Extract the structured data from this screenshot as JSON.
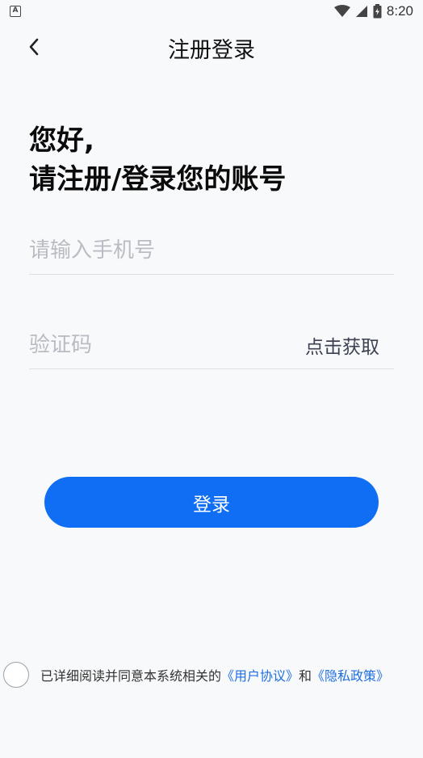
{
  "status_bar": {
    "left_icon": "A",
    "icons": [
      "wifi-icon",
      "signal-icon",
      "battery-icon"
    ],
    "time": "8:20"
  },
  "nav": {
    "back_icon": "chevron-left-icon",
    "title": "注册登录"
  },
  "greeting": {
    "line1": "您好,",
    "line2": "请注册/登录您的账号"
  },
  "phone_field": {
    "value": "",
    "placeholder": "请输入手机号"
  },
  "code_field": {
    "value": "",
    "placeholder": "验证码",
    "get_code_label": "点击获取"
  },
  "login_button": {
    "label": "登录"
  },
  "agreement": {
    "text": "已详细阅读并同意本系统相关的",
    "user_agreement": "《用户协议》",
    "conjunction": "和",
    "privacy_policy": "《隐私政策》",
    "checked": false
  },
  "colors": {
    "primary": "#0f6ef3",
    "link": "#1f6fe0",
    "background": "#f8f9fb",
    "placeholder": "#b9bcc2"
  }
}
